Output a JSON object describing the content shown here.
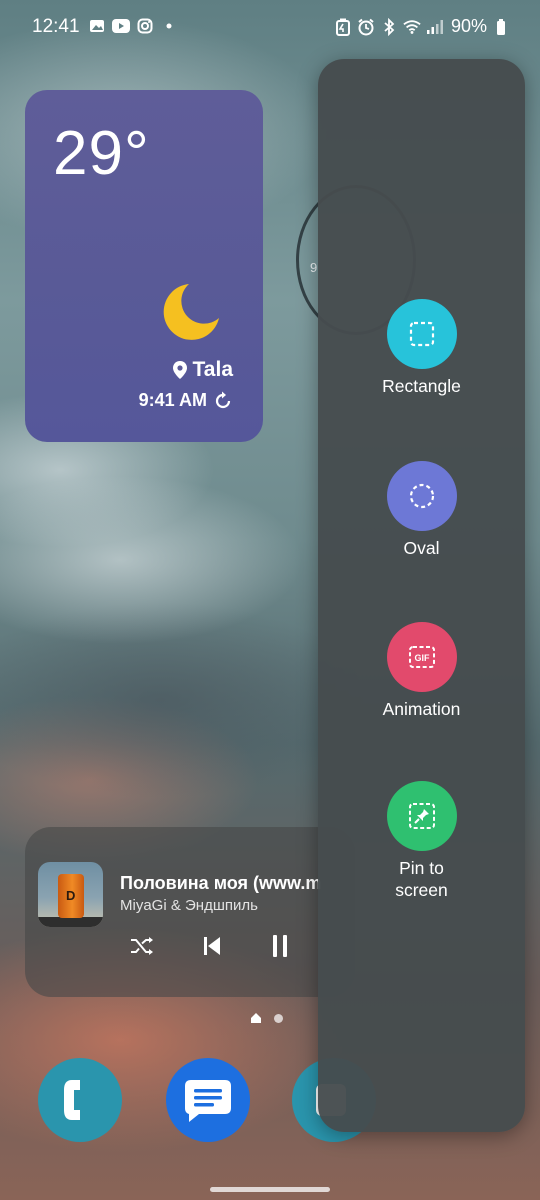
{
  "status_bar": {
    "time": "12:41",
    "left_icons": [
      "gallery-icon",
      "youtube-icon",
      "instagram-icon",
      "dot-icon"
    ],
    "right_icons": [
      "battery-saver-icon",
      "alarm-icon",
      "bluetooth-icon",
      "wifi-icon",
      "signal-icon"
    ],
    "battery_percent": "90%"
  },
  "weather_widget": {
    "temperature": "29°",
    "condition_icon": "moon-icon",
    "location": "Tala",
    "updated_time": "9:41 AM",
    "background_color": "#5b5a99",
    "moon_color": "#f5c020"
  },
  "clock_widget": {
    "visible_number": "9"
  },
  "media_player": {
    "album_letter": "D",
    "track_title": "Половина моя (www.m",
    "artist": "MiyaGi & Эндшпиль",
    "controls": [
      "shuffle-icon",
      "previous-icon",
      "pause-icon"
    ]
  },
  "page_indicator": {
    "pages": [
      "home-icon",
      "dot"
    ],
    "current": 0
  },
  "dock": {
    "apps": [
      "phone",
      "messages",
      "camera"
    ],
    "phone_color": "#2a95ad",
    "messages_color": "#1d6fe0"
  },
  "smart_select": {
    "tools": [
      {
        "label": "Rectangle",
        "icon": "dashed-square-icon",
        "color": "#27c3da"
      },
      {
        "label": "Oval",
        "icon": "dashed-circle-icon",
        "color": "#6d78d6"
      },
      {
        "label": "Animation",
        "icon": "gif-icon",
        "color": "#e24a6c"
      },
      {
        "label": "Pin to screen",
        "icon": "pin-icon",
        "color": "#2fc070"
      }
    ]
  }
}
